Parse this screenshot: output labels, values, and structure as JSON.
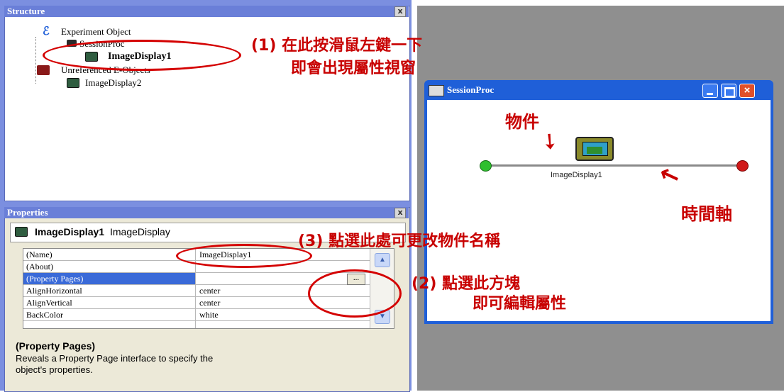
{
  "structure": {
    "title": "Structure",
    "close": "x",
    "items": [
      "Experiment Object",
      "SessionProc",
      "ImageDisplay1",
      "Unreferenced E-Objects",
      "ImageDisplay2"
    ]
  },
  "properties": {
    "title": "Properties",
    "close": "x",
    "object_name": "ImageDisplay1",
    "object_type": "ImageDisplay",
    "rows": [
      {
        "name": "(Name)",
        "value": "ImageDisplay1"
      },
      {
        "name": "(About)",
        "value": ""
      },
      {
        "name": "(Property Pages)",
        "value": ""
      },
      {
        "name": "AlignHorizontal",
        "value": "center"
      },
      {
        "name": "AlignVertical",
        "value": "center"
      },
      {
        "name": "BackColor",
        "value": "white"
      }
    ],
    "ellipsis": "...",
    "desc_title": "(Property Pages)",
    "desc_text1": "Reveals a Property Page interface to specify the",
    "desc_text2": "object's properties."
  },
  "session_window": {
    "title": "SessionProc",
    "object_label": "ImageDisplay1"
  },
  "annotations": {
    "a1_line1": "(1) 在此按滑鼠左鍵一下",
    "a1_line2": "即會出現屬性視窗",
    "a2_line1": "(2) 點選此方塊",
    "a2_line2": "即可編輯屬性",
    "a3": "(3) 點選此處可更改物件名稱",
    "obj": "物件",
    "timeline": "時間軸"
  },
  "colors": {
    "annotation_red": "#c80000",
    "title_bar": "#6a7fd8",
    "xp_blue": "#1f5fd8",
    "desktop_gray": "#8f8f8f"
  }
}
